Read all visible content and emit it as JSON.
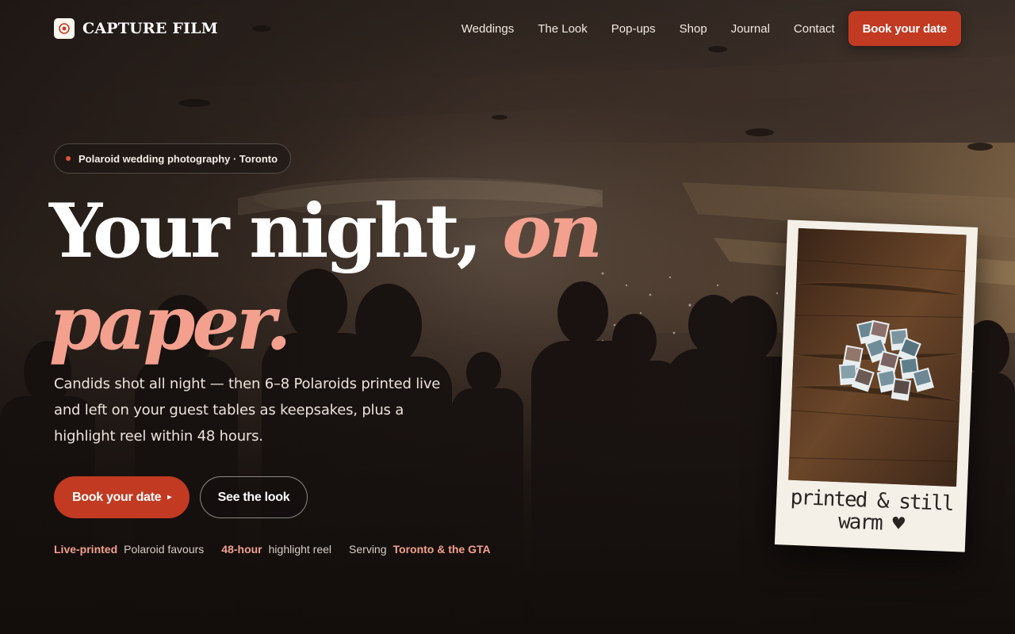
{
  "brand": {
    "name": "CAPTURE FILM",
    "logo_icon": "camera-lens-icon"
  },
  "nav": {
    "links": [
      "Weddings",
      "The Look",
      "Pop-ups",
      "Shop",
      "Journal",
      "Contact"
    ],
    "cta": "Book your date"
  },
  "hero": {
    "badge": "Polaroid wedding photography · Toronto",
    "headline_main": "Your night,",
    "headline_accent_1": "on",
    "headline_accent_2": "paper.",
    "subcopy": "Candids shot all night — then 6–8 Polaroids printed live and left on your guest tables as keepsakes, plus a highlight reel within 48 hours.",
    "primary_button": "Book your date",
    "primary_button_icon": "play-arrow-icon",
    "secondary_button": "See the look",
    "stats": [
      {
        "highlight": "Live-printed",
        "text": "Polaroid favours",
        "order": "hl-first"
      },
      {
        "highlight": "48-hour",
        "text": "highlight reel",
        "order": "hl-first"
      },
      {
        "highlight": "Toronto & the GTA",
        "text": "Serving",
        "order": "text-first"
      }
    ]
  },
  "polaroid": {
    "caption_line1": "printed & still",
    "caption_line2": "warm ♥"
  },
  "colors": {
    "accent": "#c23a22",
    "accent_light": "#f3a08e",
    "background": "#140f0d"
  }
}
